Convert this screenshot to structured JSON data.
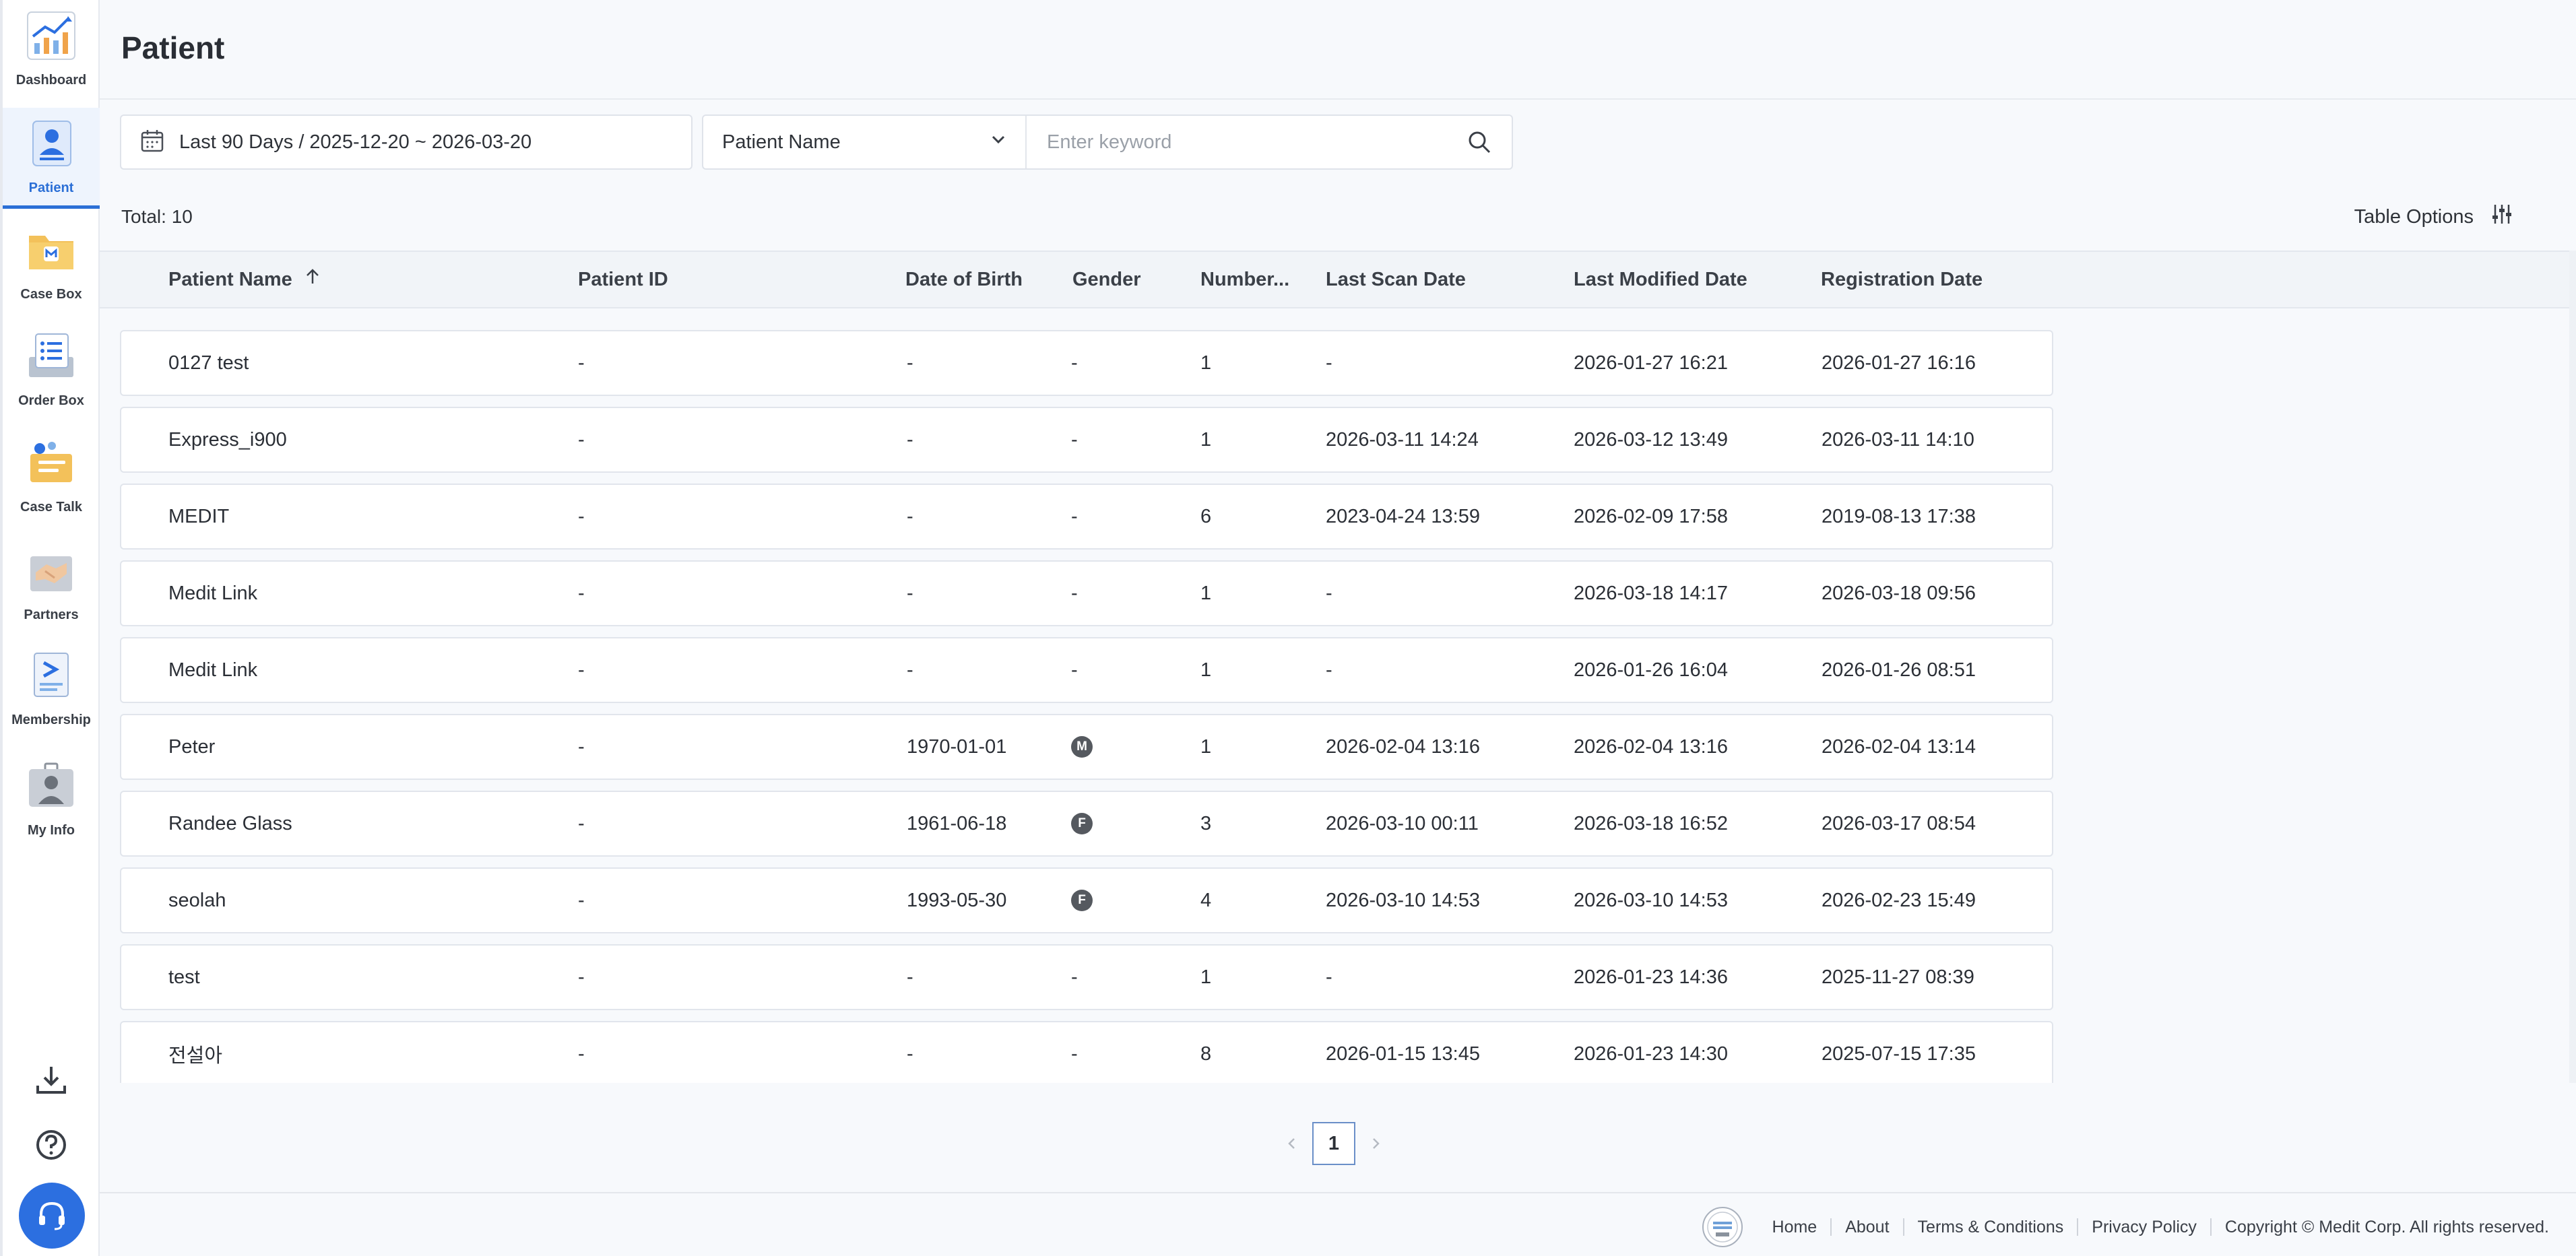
{
  "sidebar": {
    "items": [
      {
        "label": "Dashboard",
        "icon": "chart-icon",
        "active": false
      },
      {
        "label": "Patient",
        "icon": "patient-icon",
        "active": true
      },
      {
        "label": "Case Box",
        "icon": "case-box-icon",
        "active": false
      },
      {
        "label": "Order Box",
        "icon": "order-box-icon",
        "active": false
      },
      {
        "label": "Case Talk",
        "icon": "case-talk-icon",
        "active": false
      },
      {
        "label": "Partners",
        "icon": "handshake-icon",
        "active": false
      },
      {
        "label": "Membership",
        "icon": "membership-icon",
        "active": false
      },
      {
        "label": "My Info",
        "icon": "my-info-icon",
        "active": false
      }
    ],
    "utilities": [
      "download-icon",
      "help-icon",
      "headset-icon"
    ]
  },
  "header": {
    "title": "Patient"
  },
  "filters": {
    "date_range": "Last 90 Days / 2025-12-20 ~ 2026-03-20",
    "search_field": "Patient Name",
    "search_placeholder": "Enter keyword"
  },
  "summary": {
    "total": "Total: 10",
    "table_options": "Table Options"
  },
  "table": {
    "columns": [
      "Patient Name",
      "Patient ID",
      "Date of Birth",
      "Gender",
      "Number...",
      "Last Scan Date",
      "Last Modified Date",
      "Registration Date"
    ],
    "rows": [
      {
        "name": "0127 test",
        "id": "-",
        "dob": "-",
        "gender": "-",
        "number": "1",
        "last_scan": "-",
        "last_modified": "2026-01-27 16:21",
        "registered": "2026-01-27 16:16"
      },
      {
        "name": "Express_i900",
        "id": "-",
        "dob": "-",
        "gender": "-",
        "number": "1",
        "last_scan": "2026-03-11 14:24",
        "last_modified": "2026-03-12 13:49",
        "registered": "2026-03-11 14:10"
      },
      {
        "name": "MEDIT",
        "id": "-",
        "dob": "-",
        "gender": "-",
        "number": "6",
        "last_scan": "2023-04-24 13:59",
        "last_modified": "2026-02-09 17:58",
        "registered": "2019-08-13 17:38"
      },
      {
        "name": "Medit Link",
        "id": "-",
        "dob": "-",
        "gender": "-",
        "number": "1",
        "last_scan": "-",
        "last_modified": "2026-03-18 14:17",
        "registered": "2026-03-18 09:56"
      },
      {
        "name": "Medit Link",
        "id": "-",
        "dob": "-",
        "gender": "-",
        "number": "1",
        "last_scan": "-",
        "last_modified": "2026-01-26 16:04",
        "registered": "2026-01-26 08:51"
      },
      {
        "name": "Peter",
        "id": "-",
        "dob": "1970-01-01",
        "gender": "M",
        "number": "1",
        "last_scan": "2026-02-04 13:16",
        "last_modified": "2026-02-04 13:16",
        "registered": "2026-02-04 13:14"
      },
      {
        "name": "Randee Glass",
        "id": "-",
        "dob": "1961-06-18",
        "gender": "F",
        "number": "3",
        "last_scan": "2026-03-10 00:11",
        "last_modified": "2026-03-18 16:52",
        "registered": "2026-03-17 08:54"
      },
      {
        "name": "seolah",
        "id": "-",
        "dob": "1993-05-30",
        "gender": "F",
        "number": "4",
        "last_scan": "2026-03-10 14:53",
        "last_modified": "2026-03-10 14:53",
        "registered": "2026-02-23 15:49"
      },
      {
        "name": "test",
        "id": "-",
        "dob": "-",
        "gender": "-",
        "number": "1",
        "last_scan": "-",
        "last_modified": "2026-01-23 14:36",
        "registered": "2025-11-27 08:39"
      },
      {
        "name": "전설아",
        "id": "-",
        "dob": "-",
        "gender": "-",
        "number": "8",
        "last_scan": "2026-01-15 13:45",
        "last_modified": "2026-01-23 14:30",
        "registered": "2025-07-15 17:35"
      }
    ]
  },
  "pagination": {
    "current": "1"
  },
  "footer": {
    "links": [
      "Home",
      "About",
      "Terms & Conditions",
      "Privacy Policy"
    ],
    "copyright": "Copyright © Medit Corp. All rights reserved."
  },
  "colors": {
    "accent": "#2b6fd6",
    "support": "#2c6fe0"
  }
}
